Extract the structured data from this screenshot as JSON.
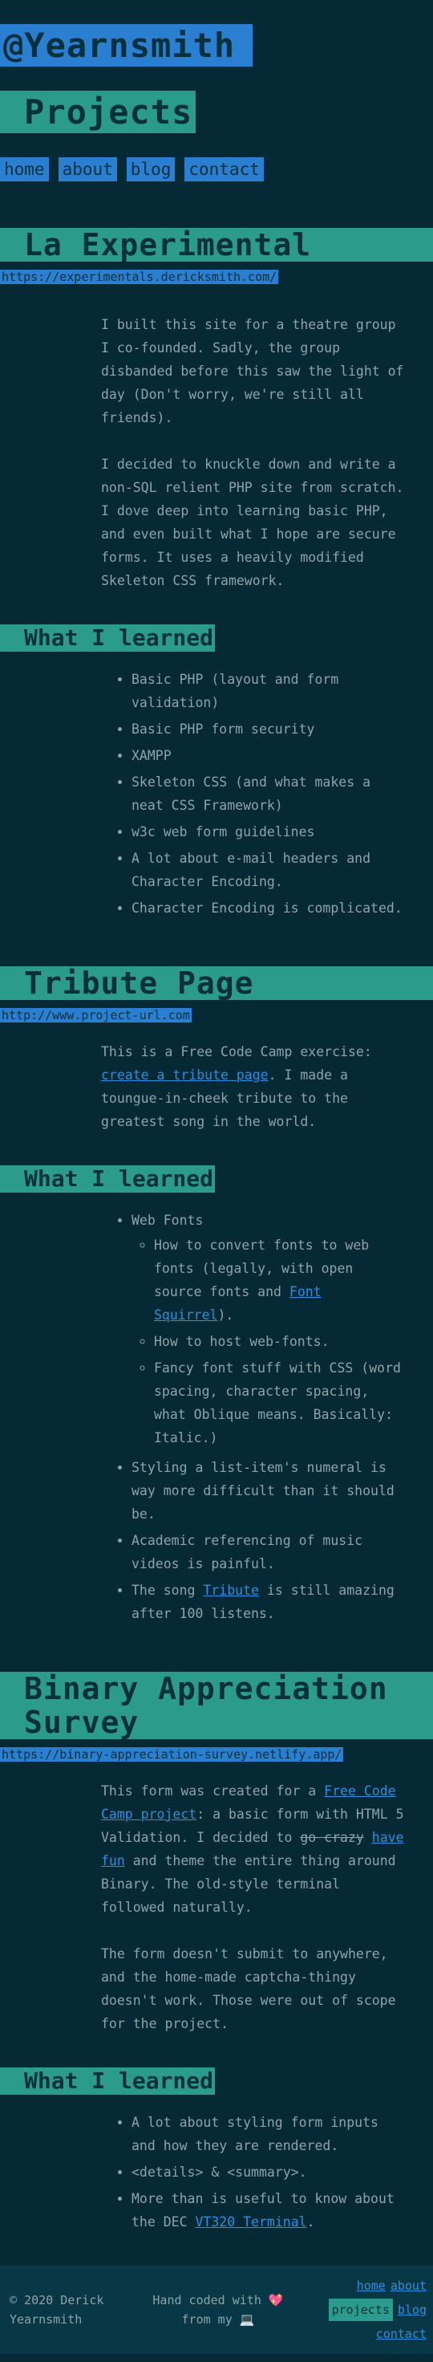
{
  "site": {
    "title": "@Yearnsmith",
    "page_title": "Projects"
  },
  "nav": {
    "home": "home",
    "about": "about",
    "blog": "blog",
    "contact": "contact"
  },
  "projects": [
    {
      "title": "La Experimental",
      "url": "https://experimentals.dericksmith.com/",
      "paragraphs": [
        "I built this site for a theatre group I co-founded. Sadly, the group disbanded before this saw the light of day (Don't worry, we're still all friends).",
        "I decided to knuckle down and write a non-SQL relient PHP site from scratch. I dove deep into learning basic PHP, and even built what I hope are secure forms. It uses a heavily modified Skeleton CSS framework."
      ],
      "learned_heading": "What I learned",
      "learned": [
        "Basic PHP (layout and form validation)",
        "Basic PHP form security",
        "XAMPP",
        "Skeleton CSS (and what makes a neat CSS Framework)",
        "w3c web form guidelines",
        "A lot about e-mail headers and Character Encoding.",
        "Character Encoding is complicated."
      ]
    },
    {
      "title": "Tribute Page",
      "url": "http://www.project-url.com",
      "para_prefix": "This is a Free Code Camp exercise: ",
      "para_link": "create a tribute page",
      "para_suffix": ". I made a toungue-in-cheek tribute to the greatest song in the world.",
      "learned_heading": "What I learned",
      "web_fonts": "Web Fonts",
      "sub1_prefix": "How to convert fonts to web fonts (legally, with open source fonts and ",
      "sub1_link": "Font Squirrel",
      "sub1_suffix": ").",
      "sub2": "How to host web-fonts.",
      "sub3": "Fancy font stuff with CSS (word spacing, character spacing, what Oblique means. Basically: Italic.)",
      "item2": "Styling a list-item's numeral is way more difficult than it should be.",
      "item3": "Academic referencing of music videos is painful.",
      "item4_prefix": "The song ",
      "item4_link": "Tribute",
      "item4_suffix": " is still amazing after 100 listens."
    },
    {
      "title": "Binary Appreciation Survey",
      "url": "https://binary-appreciation-survey.netlify.app/",
      "p1_prefix": "This form was created for a ",
      "p1_link": "Free Code Camp project",
      "p1_mid": ": a basic form with HTML 5 Validation. I decided to ",
      "p1_strike": "go crazy",
      "p1_space": " ",
      "p1_link2": "have fun",
      "p1_suffix": " and theme the entire thing around Binary. The old-style terminal followed naturally.",
      "p2": "The form doesn't submit to anywhere, and the home-made captcha-thingy doesn't work. Those were out of scope for the project.",
      "learned_heading": "What I learned",
      "item1": "A lot about styling form inputs and how they are rendered.",
      "item2": "<details> & <summary>.",
      "item3_prefix": "More than is useful to know about the DEC ",
      "item3_link": "VT320 Terminal",
      "item3_suffix": "."
    }
  ],
  "footer": {
    "copyright": "© 2020 Derick Yearnsmith",
    "coded_prefix": "Hand coded with",
    "coded_from": "from my",
    "heart": "💖",
    "laptop": "💻",
    "nav_home": "home",
    "nav_about": "about",
    "nav_projects": "projects",
    "nav_blog": "blog",
    "nav_contact": "contact"
  },
  "colors": {
    "background": "#062a35",
    "accent_blue": "#2a7fd0",
    "accent_teal": "#2a9b8c",
    "text": "#8ea3a8",
    "link": "#2a8fe0"
  }
}
